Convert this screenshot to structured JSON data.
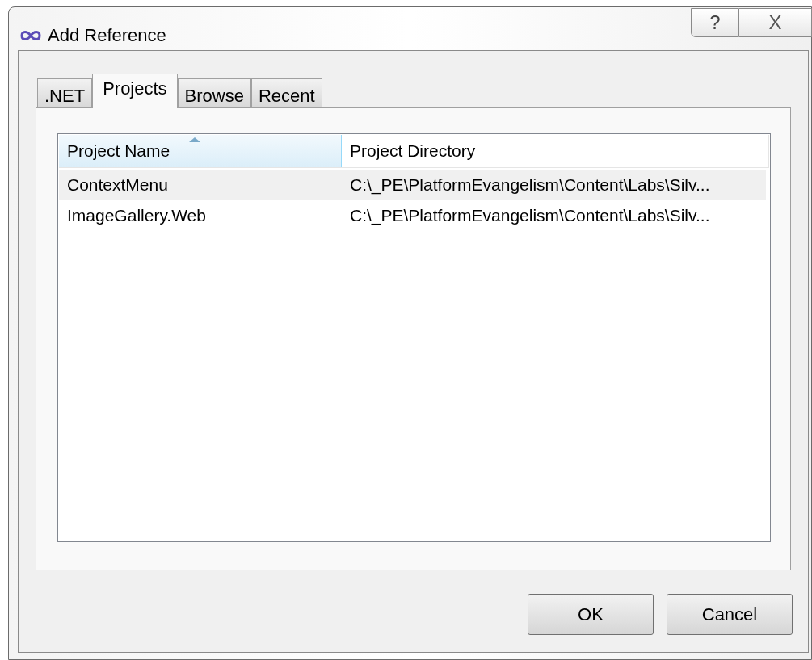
{
  "window": {
    "title": "Add Reference",
    "help": "?",
    "close": "X"
  },
  "tabs": [
    {
      "label": ".NET",
      "selected": false
    },
    {
      "label": "Projects",
      "selected": true
    },
    {
      "label": "Browse",
      "selected": false
    },
    {
      "label": "Recent",
      "selected": false
    }
  ],
  "table": {
    "columns": [
      {
        "label": "Project Name",
        "sorted": true
      },
      {
        "label": "Project Directory",
        "sorted": false
      }
    ],
    "rows": [
      {
        "cells": [
          "ContextMenu",
          "C:\\_PE\\PlatformEvangelism\\Content\\Labs\\Silv..."
        ],
        "selected": true
      },
      {
        "cells": [
          "ImageGallery.Web",
          "C:\\_PE\\PlatformEvangelism\\Content\\Labs\\Silv..."
        ],
        "selected": false
      }
    ]
  },
  "buttons": [
    "OK",
    "Cancel"
  ]
}
